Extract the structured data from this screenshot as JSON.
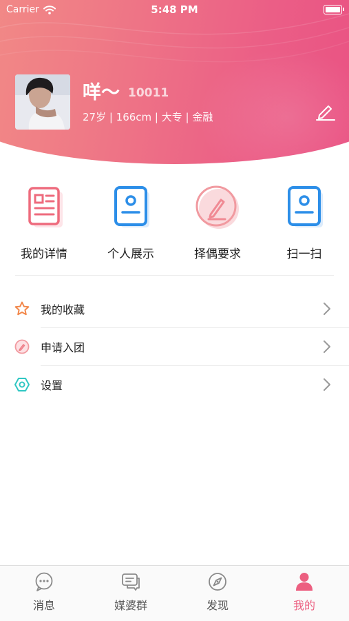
{
  "status_bar": {
    "carrier": "Carrier",
    "time": "5:48 PM"
  },
  "profile": {
    "name": "咩～",
    "user_id": "10011",
    "details": "27岁 | 166cm | 大专 | 金融"
  },
  "quick_actions": [
    {
      "label": "我的详情",
      "icon": "document-icon"
    },
    {
      "label": "个人展示",
      "icon": "id-card-icon"
    },
    {
      "label": "择偶要求",
      "icon": "pen-circle-icon"
    },
    {
      "label": "扫一扫",
      "icon": "scan-icon"
    }
  ],
  "menu": [
    {
      "label": "我的收藏",
      "icon": "star-icon"
    },
    {
      "label": "申请入团",
      "icon": "apply-icon"
    },
    {
      "label": "设置",
      "icon": "settings-icon"
    }
  ],
  "tabs": [
    {
      "label": "消息",
      "icon": "chat-bubble-icon"
    },
    {
      "label": "媒婆群",
      "icon": "group-chat-icon"
    },
    {
      "label": "发现",
      "icon": "compass-icon"
    },
    {
      "label": "我的",
      "icon": "person-icon",
      "active": true
    }
  ],
  "colors": {
    "accent": "#ec5f80",
    "header_start": "#f39187",
    "header_end": "#e94e82",
    "blue": "#2c8ee8",
    "teal": "#2fc7c3",
    "orange": "#f2874a"
  }
}
